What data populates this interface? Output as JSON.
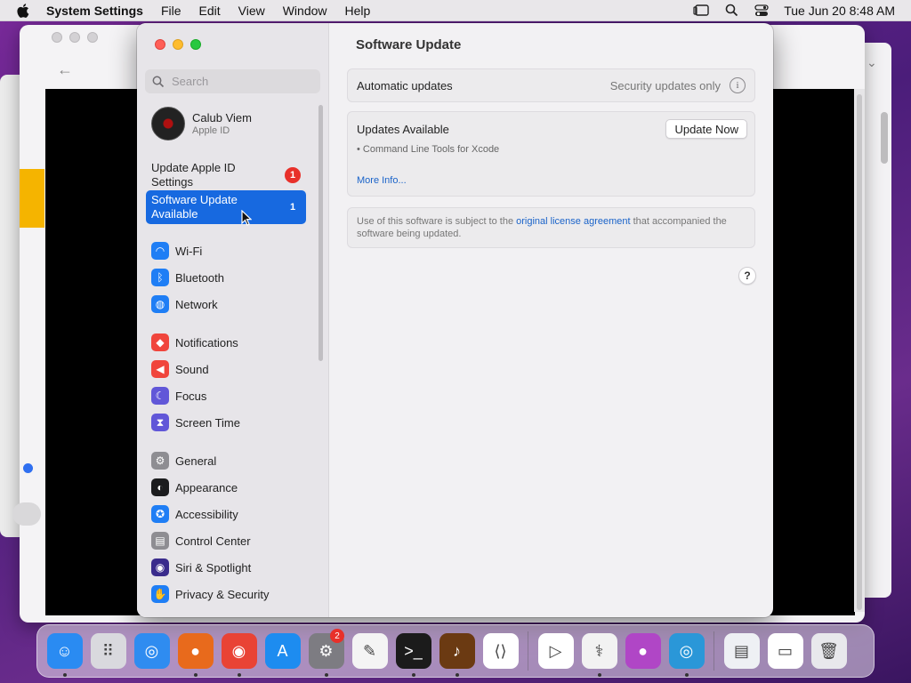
{
  "menubar": {
    "app_name": "System Settings",
    "menus": [
      "File",
      "Edit",
      "View",
      "Window",
      "Help"
    ],
    "datetime": "Tue Jun 20  8:48 AM"
  },
  "window": {
    "title": "Software Update"
  },
  "sidebar": {
    "search_placeholder": "Search",
    "profile": {
      "name": "Calub Viem",
      "subtitle": "Apple ID"
    },
    "apple_id_notice": {
      "label": "Update Apple ID Settings",
      "badge": "1"
    },
    "software_update_notice": {
      "label": "Software Update Available",
      "badge": "1"
    },
    "groups": [
      [
        {
          "label": "Wi-Fi",
          "icon": "wifi-icon",
          "color": "#1f7ef5"
        },
        {
          "label": "Bluetooth",
          "icon": "bluetooth-icon",
          "color": "#1f7ef5"
        },
        {
          "label": "Network",
          "icon": "globe-icon",
          "color": "#1f7ef5"
        }
      ],
      [
        {
          "label": "Notifications",
          "icon": "bell-icon",
          "color": "#f0453c"
        },
        {
          "label": "Sound",
          "icon": "speaker-icon",
          "color": "#f0453c"
        },
        {
          "label": "Focus",
          "icon": "moon-icon",
          "color": "#6157d8"
        },
        {
          "label": "Screen Time",
          "icon": "hourglass-icon",
          "color": "#6157d8"
        }
      ],
      [
        {
          "label": "General",
          "icon": "gear-icon",
          "color": "#8e8d92"
        },
        {
          "label": "Appearance",
          "icon": "appearance-icon",
          "color": "#1c1c1e"
        },
        {
          "label": "Accessibility",
          "icon": "accessibility-icon",
          "color": "#1f7ef5"
        },
        {
          "label": "Control Center",
          "icon": "control-center-icon",
          "color": "#8e8d92"
        },
        {
          "label": "Siri & Spotlight",
          "icon": "siri-icon",
          "color": "#3a2b8c"
        },
        {
          "label": "Privacy & Security",
          "icon": "hand-icon",
          "color": "#1f7ef5"
        }
      ]
    ]
  },
  "content": {
    "automatic_updates": {
      "label": "Automatic updates",
      "value": "Security updates only"
    },
    "updates_available": {
      "title": "Updates Available",
      "items": [
        "• Command Line Tools for Xcode"
      ],
      "more_info": "More Info...",
      "button": "Update Now"
    },
    "license": {
      "before": "Use of this software is subject to the ",
      "link": "original license agreement",
      "after": " that accompanied the software being updated."
    },
    "help": "?"
  },
  "dock": {
    "apps": [
      {
        "name": "finder-icon",
        "color": "#2a8bf2",
        "glyph": "☺",
        "running": true
      },
      {
        "name": "launchpad-icon",
        "color": "#d9d9de",
        "glyph": "⠿",
        "running": false
      },
      {
        "name": "safari-icon",
        "color": "#2f8cf0",
        "glyph": "◎",
        "running": false
      },
      {
        "name": "firefox-icon",
        "color": "#e86a1c",
        "glyph": "●",
        "running": true
      },
      {
        "name": "chrome-icon",
        "color": "#e94335",
        "glyph": "◉",
        "running": true
      },
      {
        "name": "app-store-icon",
        "color": "#1d8cf0",
        "glyph": "A",
        "running": false
      },
      {
        "name": "system-settings-icon",
        "color": "#7d7c82",
        "glyph": "⚙",
        "running": true,
        "badge": "2"
      },
      {
        "name": "textedit-icon",
        "color": "#f4f4f4",
        "glyph": "✎",
        "running": false
      },
      {
        "name": "terminal-icon",
        "color": "#1b1b1b",
        "glyph": ">_",
        "running": true
      },
      {
        "name": "instruments-icon",
        "color": "#6b3a12",
        "glyph": "♪",
        "running": true
      },
      {
        "name": "vscode-icon",
        "color": "#ffffff",
        "glyph": "⟨⟩",
        "running": false
      }
    ],
    "apps2": [
      {
        "name": "visual-studio-icon",
        "color": "#ffffff",
        "glyph": "▷",
        "running": false
      },
      {
        "name": "disk-utility-icon",
        "color": "#f2f2f2",
        "glyph": "⚕",
        "running": true
      },
      {
        "name": "purple-app-icon",
        "color": "#b046c6",
        "glyph": "●",
        "running": false
      },
      {
        "name": "blue-app-icon",
        "color": "#2a97d8",
        "glyph": "◎",
        "running": true
      }
    ],
    "right": [
      {
        "name": "downloads-stack-icon",
        "color": "#eef0f4",
        "glyph": "▤"
      },
      {
        "name": "window-preview-icon",
        "color": "#ffffff",
        "glyph": "▭"
      },
      {
        "name": "trash-icon",
        "color": "#e8e8ec",
        "glyph": "🗑"
      }
    ]
  }
}
